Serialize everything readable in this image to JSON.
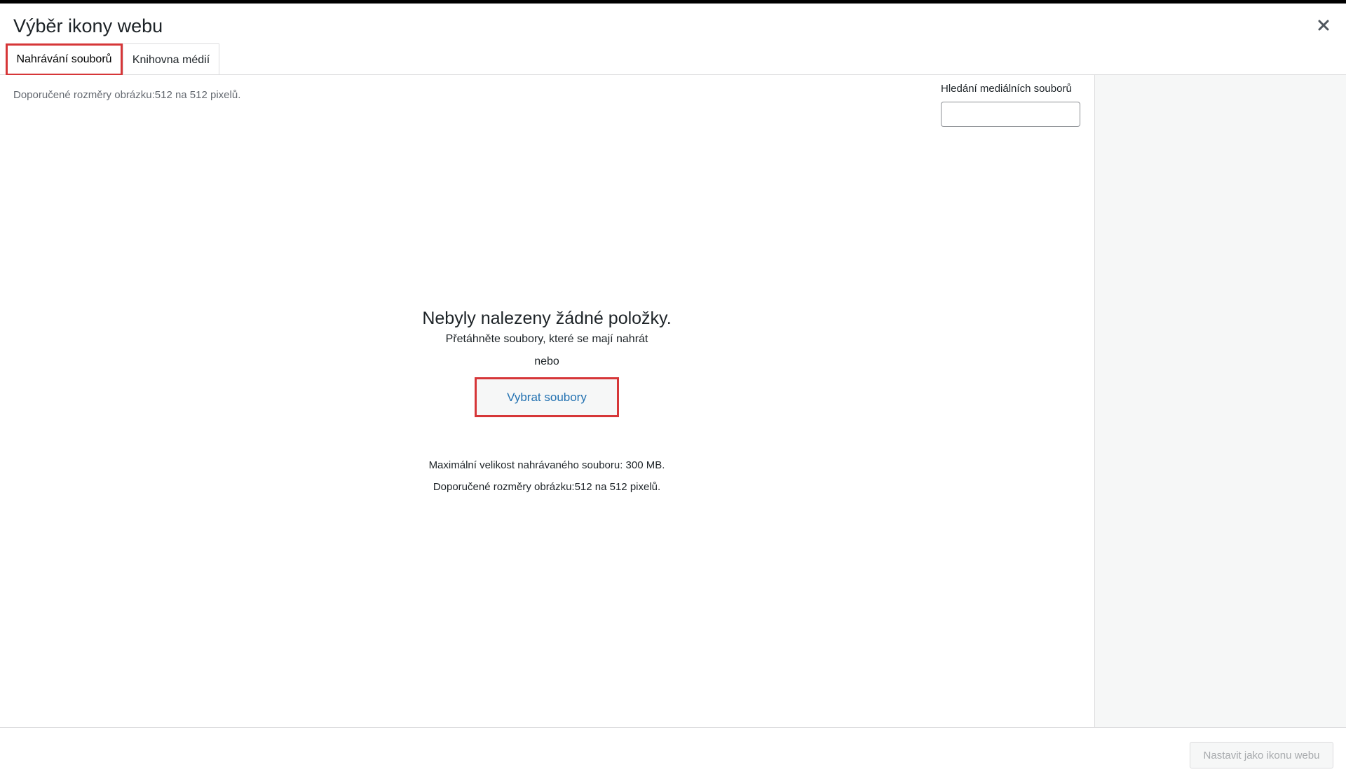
{
  "modal": {
    "title": "Výběr ikony webu",
    "close_icon": "close-icon"
  },
  "tabs": [
    {
      "label": "Nahrávání souborů",
      "active": true
    },
    {
      "label": "Knihovna médií",
      "active": false
    }
  ],
  "content": {
    "recommended_hint": "Doporučené rozměry obrázku:512 na 512 pixelů.",
    "search": {
      "label": "Hledání mediálních souborů",
      "value": ""
    },
    "uploader": {
      "heading": "Nebyly nalezeny žádné položky.",
      "drag_text": "Přetáhněte soubory, které se mají nahrát",
      "or_text": "nebo",
      "select_button": "Vybrat soubory",
      "max_size": "Maximální velikost nahrávaného souboru: 300 MB.",
      "recommended": "Doporučené rozměry obrázku:512 na 512 pixelů."
    }
  },
  "footer": {
    "set_icon_button": "Nastavit jako ikonu webu"
  },
  "colors": {
    "highlight": "#d63638",
    "link": "#2271b1",
    "sidebar_bg": "#f6f7f7",
    "disabled_text": "#a7aaad"
  }
}
